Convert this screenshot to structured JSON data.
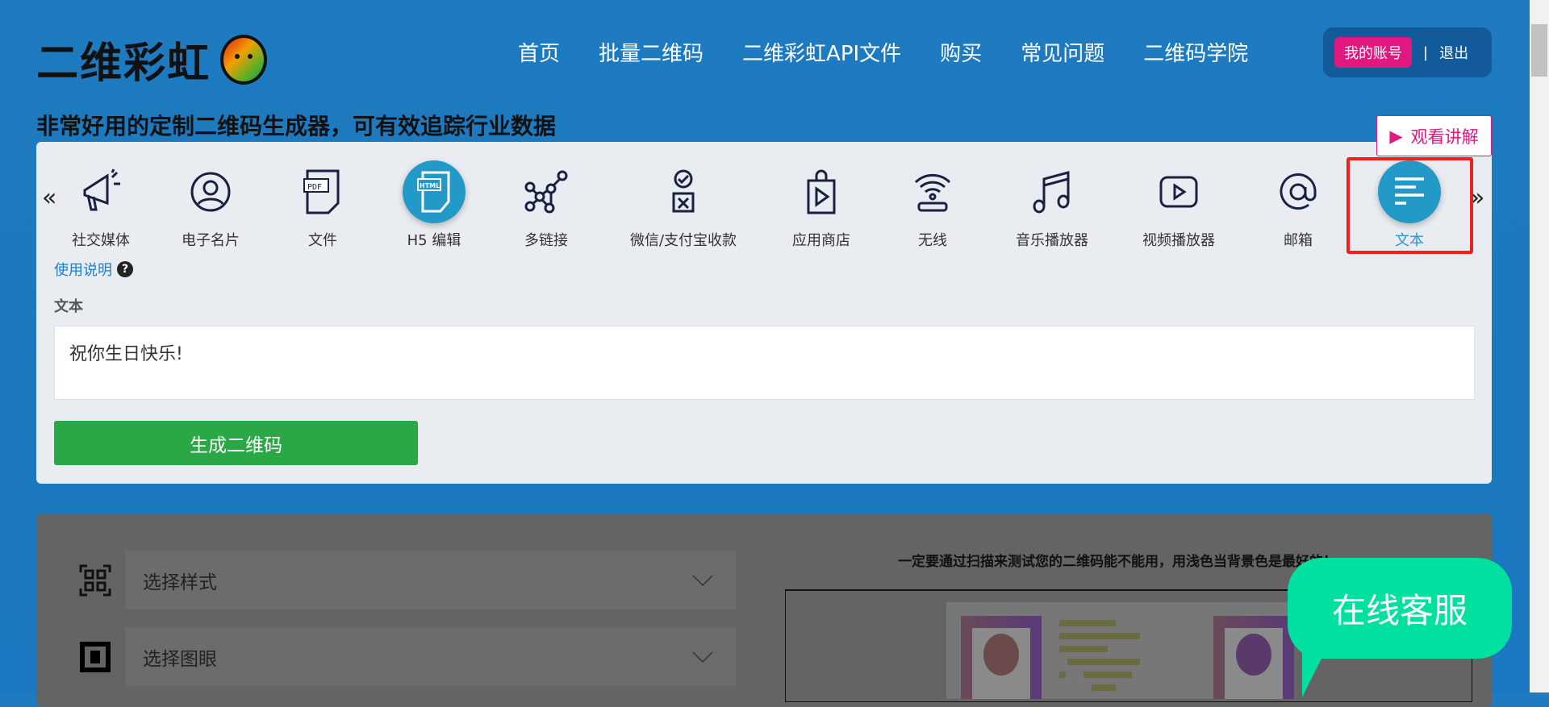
{
  "header": {
    "logo": "二维彩虹",
    "nav": [
      "首页",
      "批量二维码",
      "二维彩虹API文件",
      "购买",
      "常见问题",
      "二维码学院"
    ],
    "account": "我的账号",
    "separator": "|",
    "logout": "退出"
  },
  "subtitle": "非常好用的定制二维码生成器，可有效追踪行业数据",
  "watch_button": "观看讲解",
  "types": [
    {
      "label": "社交媒体",
      "icon": "megaphone-icon"
    },
    {
      "label": "电子名片",
      "icon": "user-circle-icon"
    },
    {
      "label": "文件",
      "icon": "pdf-file-icon",
      "badge": "PDF"
    },
    {
      "label": "H5 编辑",
      "icon": "html-file-icon",
      "badge": "HTML"
    },
    {
      "label": "多链接",
      "icon": "network-icon"
    },
    {
      "label": "微信/支付宝收款",
      "icon": "payment-icon"
    },
    {
      "label": "应用商店",
      "icon": "store-bag-icon"
    },
    {
      "label": "无线",
      "icon": "wifi-icon"
    },
    {
      "label": "音乐播放器",
      "icon": "music-note-icon"
    },
    {
      "label": "视频播放器",
      "icon": "video-play-icon"
    },
    {
      "label": "邮箱",
      "icon": "at-icon"
    },
    {
      "label": "文本",
      "icon": "text-lines-icon",
      "active": true
    }
  ],
  "usage_link": "使用说明",
  "usage_help": "?",
  "form": {
    "label": "文本",
    "value": "祝你生日快乐!"
  },
  "generate_button": "生成二维码",
  "options": [
    "选择样式",
    "选择图眼"
  ],
  "hint": "一定要通过扫描来测试您的二维码能不能用，用浅色当背景色是最好的！",
  "chat": "在线客服",
  "colors": {
    "brand_blue": "#1f7bc0",
    "accent_pink": "#e0187f",
    "active_teal": "#2399c8",
    "green": "#29a845",
    "chat": "#00e0a0"
  }
}
